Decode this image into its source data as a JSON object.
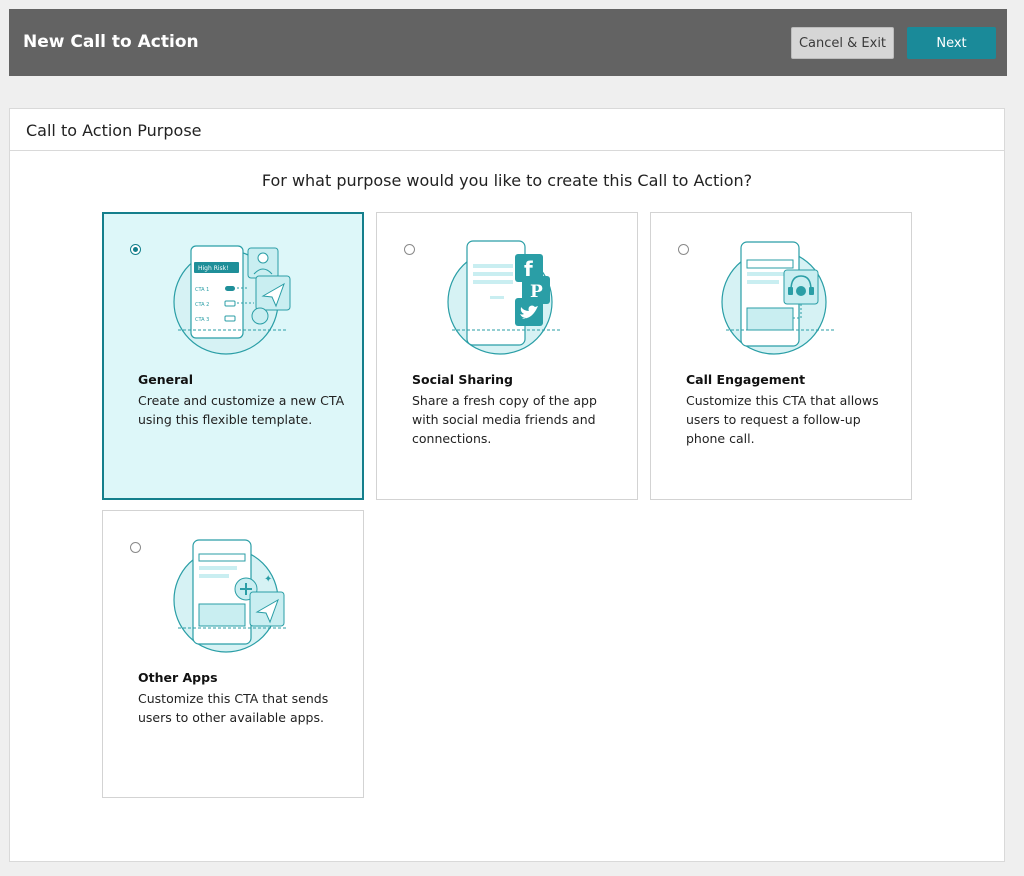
{
  "header": {
    "title": "New Call to Action",
    "cancel_label": "Cancel & Exit",
    "next_label": "Next"
  },
  "panel": {
    "title": "Call to Action Purpose",
    "question": "For what purpose would you like to create this Call to Action?"
  },
  "colors": {
    "header_bg": "#636363",
    "accent": "#1a8a99",
    "selected_bg": "#ddf7f9",
    "illustration": "#2a9ea6"
  },
  "options": [
    {
      "title": "General",
      "description": "Create and customize a new CTA using this flexible template.",
      "selected": true,
      "icon": "general-cta-illustration",
      "badge": "High Risk!",
      "items": [
        "CTA 1",
        "CTA 2",
        "CTA 3"
      ]
    },
    {
      "title": "Social Sharing",
      "description": "Share a fresh copy of the app with social media friends and connections.",
      "selected": false,
      "icon": "social-sharing-illustration"
    },
    {
      "title": "Call Engagement",
      "description": "Customize this CTA that allows users to request a follow-up phone call.",
      "selected": false,
      "icon": "call-engagement-illustration"
    },
    {
      "title": "Other Apps",
      "description": "Customize this CTA that sends users to other available apps.",
      "selected": false,
      "icon": "other-apps-illustration"
    }
  ]
}
